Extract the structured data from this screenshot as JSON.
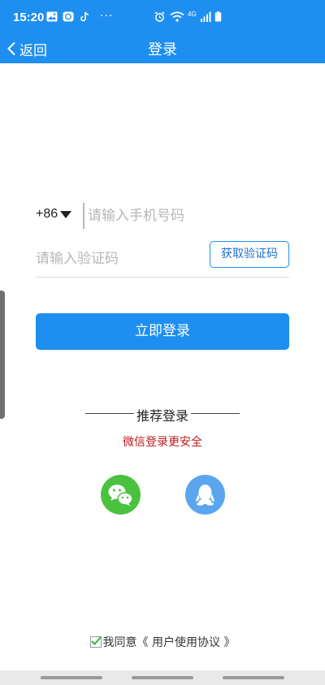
{
  "status_bar": {
    "time": "15:20",
    "dots": "···",
    "network_label": "4G"
  },
  "nav": {
    "back_label": "返回",
    "title": "登录"
  },
  "phone": {
    "country_code": "+86",
    "placeholder": "请输入手机号码",
    "value": ""
  },
  "code": {
    "placeholder": "请输入验证码",
    "value": "",
    "get_code_label": "获取验证码"
  },
  "login_button": {
    "label": "立即登录"
  },
  "recommend": {
    "title": "推荐登录",
    "notice": "微信登录更安全"
  },
  "social": {
    "items": [
      {
        "icon": "wechat-icon"
      },
      {
        "icon": "qq-icon"
      }
    ]
  },
  "agreement": {
    "checked": true,
    "prefix": "我同意《",
    "link": " 用户使用协议 ",
    "suffix": "》"
  },
  "colors": {
    "primary": "#1e8ff0",
    "notice_red": "#c0191b",
    "wechat_green": "#4bc23f",
    "qq_blue": "#5aa6ee"
  }
}
